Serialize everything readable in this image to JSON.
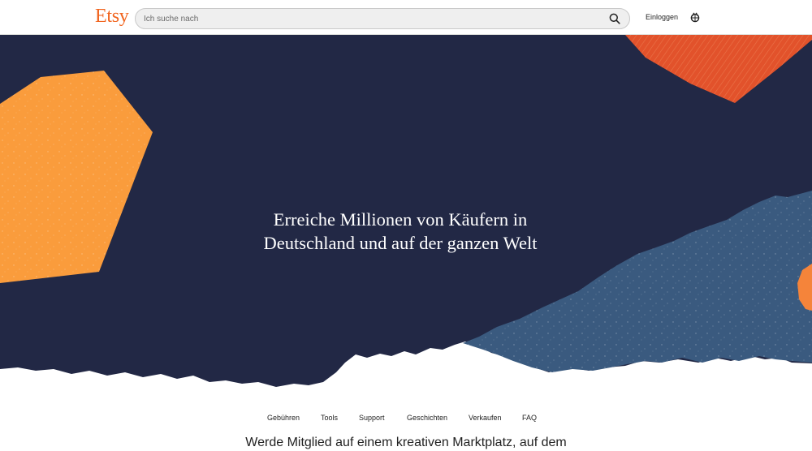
{
  "header": {
    "logo": "Etsy",
    "search_placeholder": "Ich suche nach",
    "signin_label": "Einloggen",
    "search_icon": "search-icon",
    "cart_icon": "cart-icon"
  },
  "hero": {
    "title_line1": "Erreiche Millionen von Käufern in",
    "title_line2": "Deutschland und auf der ganzen Welt",
    "colors": {
      "background": "#222845",
      "orange_shape": "#fa9c3c",
      "red_shape": "#e2522b",
      "blue_shape": "#3a5a7f"
    }
  },
  "subnav": {
    "items": [
      {
        "label": "Gebühren"
      },
      {
        "label": "Tools"
      },
      {
        "label": "Support"
      },
      {
        "label": "Geschichten"
      },
      {
        "label": "Verkaufen"
      },
      {
        "label": "FAQ"
      }
    ]
  },
  "join": {
    "text": "Werde Mitglied auf einem kreativen Marktplatz, auf dem"
  },
  "brand": {
    "accent": "#f1641e"
  }
}
